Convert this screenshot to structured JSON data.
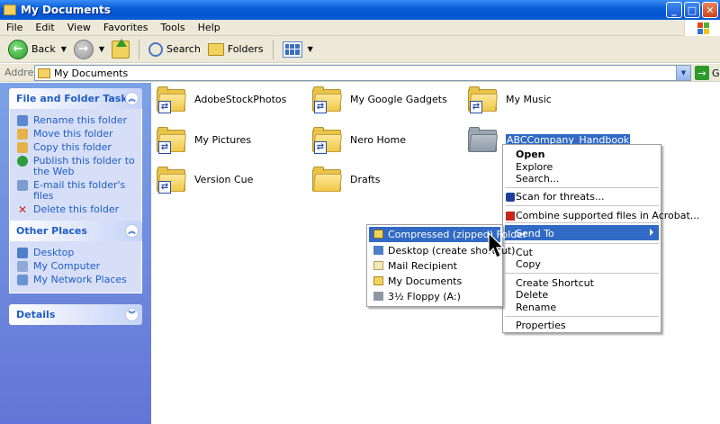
{
  "window": {
    "title": "My Documents"
  },
  "menu": [
    "File",
    "Edit",
    "View",
    "Favorites",
    "Tools",
    "Help"
  ],
  "toolbar": {
    "back": "Back",
    "search": "Search",
    "folders": "Folders"
  },
  "address": {
    "label": "Address",
    "value": "My Documents",
    "go": "Go"
  },
  "panels": {
    "tasks": {
      "title": "File and Folder Tasks",
      "items": [
        "Rename this folder",
        "Move this folder",
        "Copy this folder",
        "Publish this folder to the Web",
        "E-mail this folder's files",
        "Delete this folder"
      ]
    },
    "places": {
      "title": "Other Places",
      "items": [
        "Desktop",
        "My Computer",
        "My Network Places"
      ]
    },
    "details": {
      "title": "Details"
    }
  },
  "files": [
    {
      "name": "AdobeStockPhotos"
    },
    {
      "name": "My Google Gadgets"
    },
    {
      "name": "My Music"
    },
    {
      "name": "My Pictures"
    },
    {
      "name": "Nero Home"
    },
    {
      "name": "ABCCompany_Handbook"
    },
    {
      "name": "Version Cue"
    },
    {
      "name": "Drafts"
    }
  ],
  "context_menu": {
    "open": "Open",
    "explore": "Explore",
    "search": "Search...",
    "scan": "Scan for threats...",
    "combine": "Combine supported files in Acrobat...",
    "send_to": "Send To",
    "cut": "Cut",
    "copy": "Copy",
    "create_shortcut": "Create Shortcut",
    "delete": "Delete",
    "rename": "Rename",
    "properties": "Properties"
  },
  "send_to_menu": [
    "Compressed (zipped) Folder",
    "Desktop (create shortcut)",
    "Mail Recipient",
    "My Documents",
    "3½ Floppy (A:)"
  ],
  "colors": {
    "title_blue": "#0a5fd8",
    "highlight": "#316ac5",
    "task_blue": "#215dc6"
  }
}
